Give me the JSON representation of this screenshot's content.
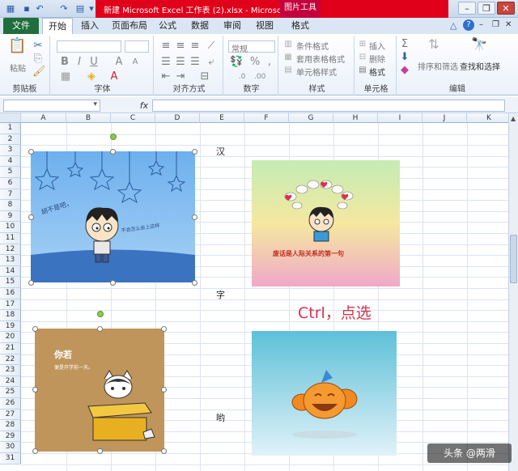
{
  "window": {
    "title": "新建 Microsoft Excel 工作表 (2).xlsx - Microso...",
    "context_tab_group": "图片工具"
  },
  "tabs": [
    {
      "label": "文件"
    },
    {
      "label": "开始"
    },
    {
      "label": "插入"
    },
    {
      "label": "页面布局"
    },
    {
      "label": "公式"
    },
    {
      "label": "数据"
    },
    {
      "label": "审阅"
    },
    {
      "label": "视图"
    },
    {
      "label": "格式"
    }
  ],
  "ribbon": {
    "clipboard": {
      "paste": "粘贴",
      "label": "剪贴板"
    },
    "font": {
      "label": "字体"
    },
    "alignment": {
      "label": "对齐方式"
    },
    "number": {
      "format": "常规",
      "label": "数字"
    },
    "styles": {
      "conditional": "条件格式",
      "table": "套用表格格式",
      "cell_styles": "单元格样式",
      "label": "样式"
    },
    "cells": {
      "insert": "插入",
      "delete": "删除",
      "format": "格式",
      "label": "单元格"
    },
    "editing": {
      "sort_filter": "排序和筛选",
      "find_select": "查找和选择",
      "label": "编辑"
    }
  },
  "formula_bar": {
    "fx": "fx",
    "name": "",
    "value": ""
  },
  "grid": {
    "columns": [
      "A",
      "B",
      "C",
      "D",
      "E",
      "F",
      "G",
      "H",
      "I",
      "J",
      "K"
    ],
    "rows": [
      "1",
      "2",
      "3",
      "4",
      "5",
      "6",
      "7",
      "8",
      "9",
      "10",
      "11",
      "12",
      "13",
      "14",
      "15",
      "16",
      "17",
      "18",
      "19",
      "20",
      "21",
      "22",
      "23",
      "24",
      "25",
      "26",
      "27",
      "28",
      "29",
      "30",
      "31"
    ],
    "cells": [
      {
        "ref": "E3",
        "text": "汉"
      },
      {
        "ref": "E16",
        "text": "字"
      },
      {
        "ref": "E28",
        "text": "哟"
      }
    ],
    "annotation": "Ctrl，点选"
  },
  "pictures": [
    {
      "caption_1": "胡不是吧，",
      "caption_2": "不会怎么会上这样"
    },
    {
      "caption": "废话是人际关系的第一句"
    },
    {
      "caption_1": "你若",
      "caption_2": "便是开学前一天。"
    },
    {
      "caption": ""
    }
  ],
  "watermark": "头条 @两滑"
}
